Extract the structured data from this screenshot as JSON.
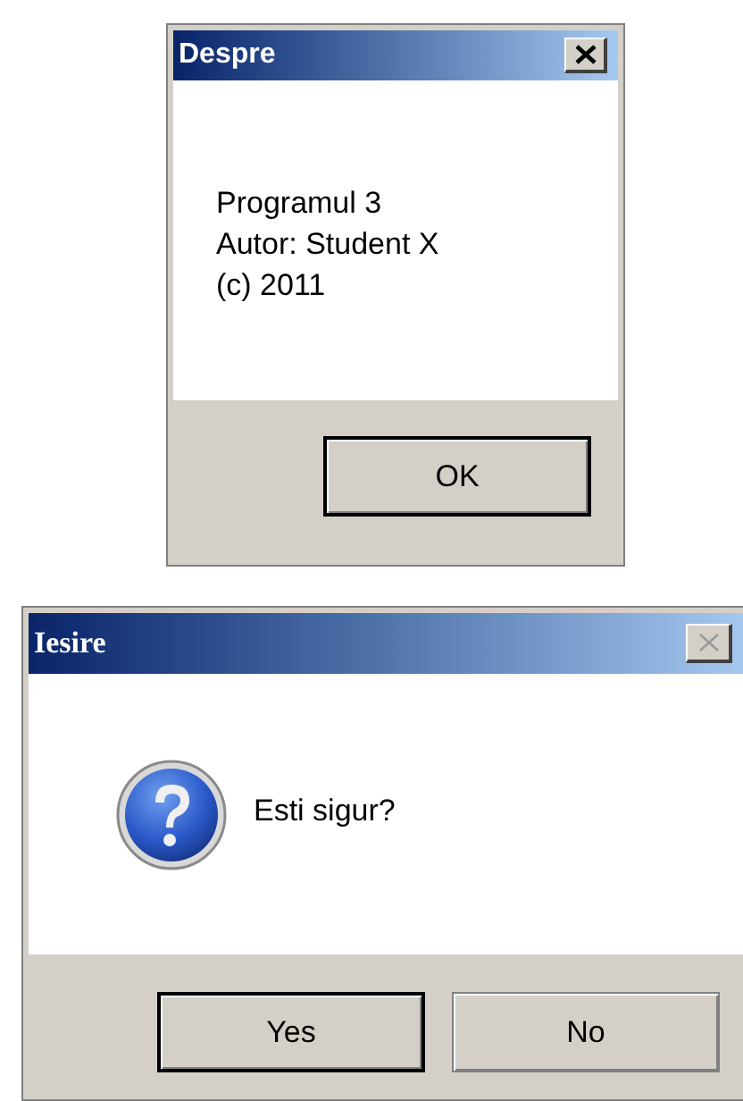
{
  "dialogs": [
    {
      "title": "Despre",
      "kind": "info",
      "close_disabled": false,
      "message_lines": [
        "Programul 3",
        "Autor: Student X",
        "(c) 2011"
      ],
      "buttons": [
        {
          "label": "OK",
          "default": true
        }
      ]
    },
    {
      "title": "Iesire",
      "kind": "question",
      "close_disabled": true,
      "message_lines": [
        "Esti sigur?"
      ],
      "buttons": [
        {
          "label": "Yes",
          "default": true
        },
        {
          "label": "No",
          "default": false
        }
      ]
    }
  ]
}
